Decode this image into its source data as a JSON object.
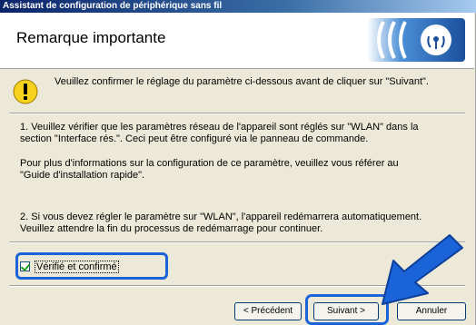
{
  "window": {
    "title": "Assistant de configuration de périphérique sans fil"
  },
  "header": {
    "title": "Remarque importante",
    "logo_icon": "wireless-signal-icon"
  },
  "notice": {
    "icon": "warning-icon",
    "text": "Veuillez confirmer le réglage du paramètre ci-dessous avant de cliquer sur \"Suivant\"."
  },
  "body": {
    "p1_line1": "1. Veuillez vérifier que les paramètres réseau de l'appareil sont réglés sur \"WLAN\" dans la",
    "p1_line2": "section \"Interface rés.\". Ceci peut être configuré via le panneau de commande.",
    "p2_line1": "Pour plus d'informations sur la configuration de ce paramètre, veuillez vous référer au",
    "p2_line2": "\"Guide d'installation rapide\".",
    "p3_line1": "2. Si vous devez régler le paramètre sur \"WLAN\", l'appareil redémarrera automatiquement.",
    "p3_line2": "Veuillez attendre la fin du processus de redémarrage pour continuer."
  },
  "confirm": {
    "label": "Vérifié et confirmé",
    "checked": true
  },
  "buttons": {
    "prev": "< Précédent",
    "next": "Suivant >",
    "cancel": "Annuler"
  },
  "colors": {
    "highlight": "#1a63d8",
    "titlebar": "#0a246a",
    "panel": "#ece9d8"
  }
}
